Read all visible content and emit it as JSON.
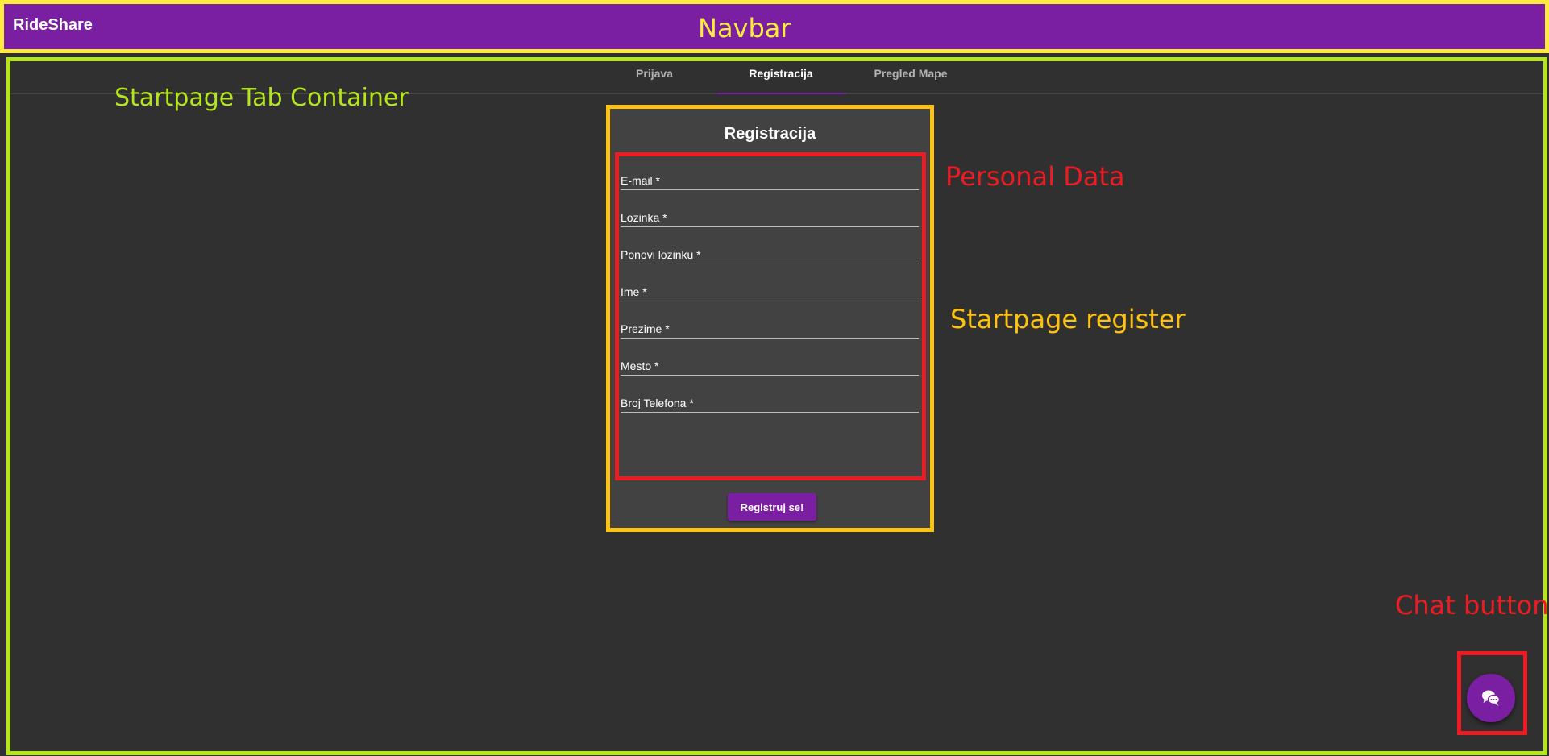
{
  "navbar": {
    "brand": "RideShare",
    "annotation": "Navbar"
  },
  "tabs": [
    {
      "label": "Prijava",
      "active": false
    },
    {
      "label": "Registracija",
      "active": true
    },
    {
      "label": "Pregled Mape",
      "active": false
    }
  ],
  "tab_container": {
    "annotation": "Startpage Tab Container"
  },
  "register": {
    "title": "Registracija",
    "annotation": "Startpage register",
    "personal_data_annotation": "Personal Data",
    "fields": [
      {
        "label": "E-mail *",
        "value": ""
      },
      {
        "label": "Lozinka *",
        "value": ""
      },
      {
        "label": "Ponovi lozinku *",
        "value": ""
      },
      {
        "label": "Ime *",
        "value": ""
      },
      {
        "label": "Prezime *",
        "value": ""
      },
      {
        "label": "Mesto *",
        "value": ""
      },
      {
        "label": "Broj Telefona *",
        "value": ""
      }
    ],
    "submit_label": "Registruj se!"
  },
  "chat": {
    "annotation": "Chat button",
    "icon": "chat-bubbles-icon"
  },
  "colors": {
    "primary": "#7b1fa2",
    "background": "#303030",
    "card": "#424242",
    "annotation_yellow": "#ffeb3b",
    "annotation_green": "#b5e61d",
    "annotation_orange": "#ffc20e",
    "annotation_red": "#ed1c24"
  }
}
